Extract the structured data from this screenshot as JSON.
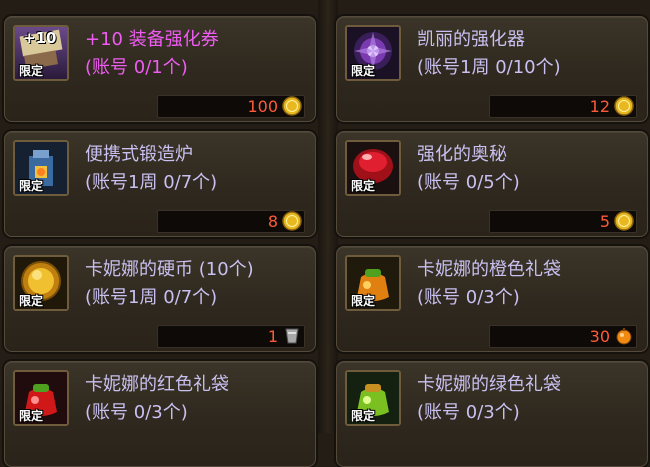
{
  "items": [
    {
      "name": "+10 装备强化券",
      "limit": "(账号 0/1个)",
      "price": "100",
      "badge": "限定",
      "icon": "upgrade-ticket-icon",
      "icon_text": "+10",
      "currency": "gold-coin-icon",
      "color": "#ee5cf2"
    },
    {
      "name": "凯丽的强化器",
      "limit": "(账号1周 0/10个)",
      "price": "12",
      "badge": "限定",
      "icon": "purple-orb-icon",
      "currency": "gold-coin-icon",
      "color": "#c8c0f0"
    },
    {
      "name": "便携式锻造炉",
      "limit": "(账号1周 0/7个)",
      "price": "8",
      "badge": "限定",
      "icon": "forge-icon",
      "currency": "gold-coin-icon",
      "color": "#c8c0f0"
    },
    {
      "name": "强化的奥秘",
      "limit": "(账号 0/5个)",
      "price": "5",
      "badge": "限定",
      "icon": "red-gem-icon",
      "currency": "gold-coin-icon",
      "color": "#c8c0f0"
    },
    {
      "name": "卡妮娜的硬币 (10个)",
      "limit": "(账号1周 0/7个)",
      "price": "1",
      "badge": "限定",
      "icon": "gold-token-icon",
      "currency": "silver-cup-icon",
      "color": "#c8c0f0"
    },
    {
      "name": "卡妮娜的橙色礼袋",
      "limit": "(账号 0/3个)",
      "price": "30",
      "badge": "限定",
      "icon": "orange-pouch-icon",
      "currency": "orange-orb-icon",
      "color": "#c8c0f0"
    },
    {
      "name": "卡妮娜的红色礼袋",
      "limit": "(账号 0/3个)",
      "price": "",
      "badge": "限定",
      "icon": "red-pouch-icon",
      "currency": "",
      "color": "#c8c0f0"
    },
    {
      "name": "卡妮娜的绿色礼袋",
      "limit": "(账号 0/3个)",
      "price": "",
      "badge": "限定",
      "icon": "green-pouch-icon",
      "currency": "",
      "color": "#c8c0f0"
    }
  ]
}
